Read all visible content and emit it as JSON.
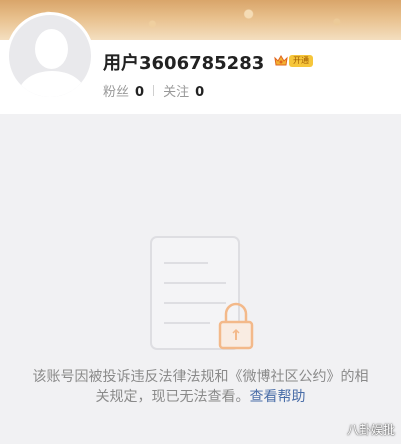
{
  "profile": {
    "username": "用户3606785283",
    "vip_label": "开通",
    "fans_label": "粉丝",
    "fans_count": "0",
    "following_label": "关注",
    "following_count": "0"
  },
  "notice": {
    "text": "该账号因被投诉违反法律法规和《微博社区公约》的相关规定，现已无法查看。",
    "help_link": "查看帮助"
  },
  "watermark": "八卦娱批",
  "icons": {
    "avatar": "default-avatar-icon",
    "vip": "crown-icon",
    "illustration": "locked-document-icon"
  },
  "colors": {
    "link": "#4a6ea8",
    "lock": "#f3b98a",
    "vip_badge": "#f6c63b"
  }
}
